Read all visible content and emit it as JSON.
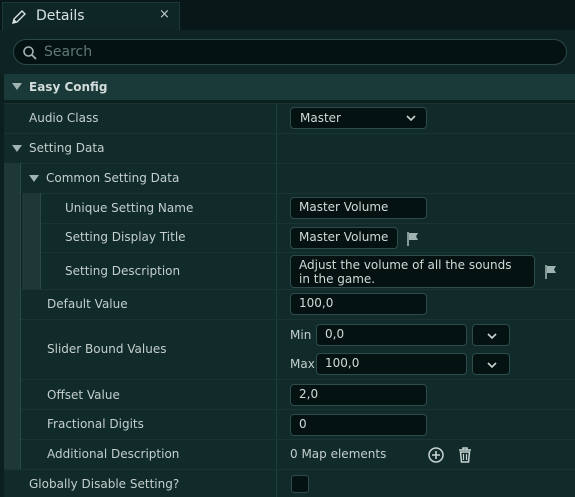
{
  "tab": {
    "title": "Details",
    "close_glyph": "×",
    "icon": "pencil-icon"
  },
  "search": {
    "placeholder": "Search"
  },
  "sections": {
    "easy_config": "Easy Config",
    "setting_data": "Setting Data",
    "common_setting_data": "Common Setting Data"
  },
  "properties": {
    "audio_class": {
      "label": "Audio Class",
      "value": "Master"
    },
    "unique_setting_name": {
      "label": "Unique Setting Name",
      "value": "Master Volume"
    },
    "setting_display_title": {
      "label": "Setting Display Title",
      "value": "Master Volume"
    },
    "setting_description": {
      "label": "Setting Description",
      "value": "Adjust the volume of all the sounds in the game."
    },
    "default_value": {
      "label": "Default Value",
      "value": "100,0"
    },
    "slider_bound_values": {
      "label": "Slider Bound Values",
      "min_label": "Min",
      "min_value": "0,0",
      "max_label": "Max",
      "max_value": "100,0"
    },
    "offset_value": {
      "label": "Offset Value",
      "value": "2,0"
    },
    "fractional_digits": {
      "label": "Fractional Digits",
      "value": "0"
    },
    "additional_description": {
      "label": "Additional Description",
      "value": "0 Map elements"
    },
    "globally_disable_setting": {
      "label": "Globally Disable Setting?",
      "checked": false
    }
  },
  "colors": {
    "background": "#0b1f1f",
    "section": "#1a3a3a",
    "row": "#112a2a",
    "field": "#041212",
    "text": "#c8d4d2"
  }
}
